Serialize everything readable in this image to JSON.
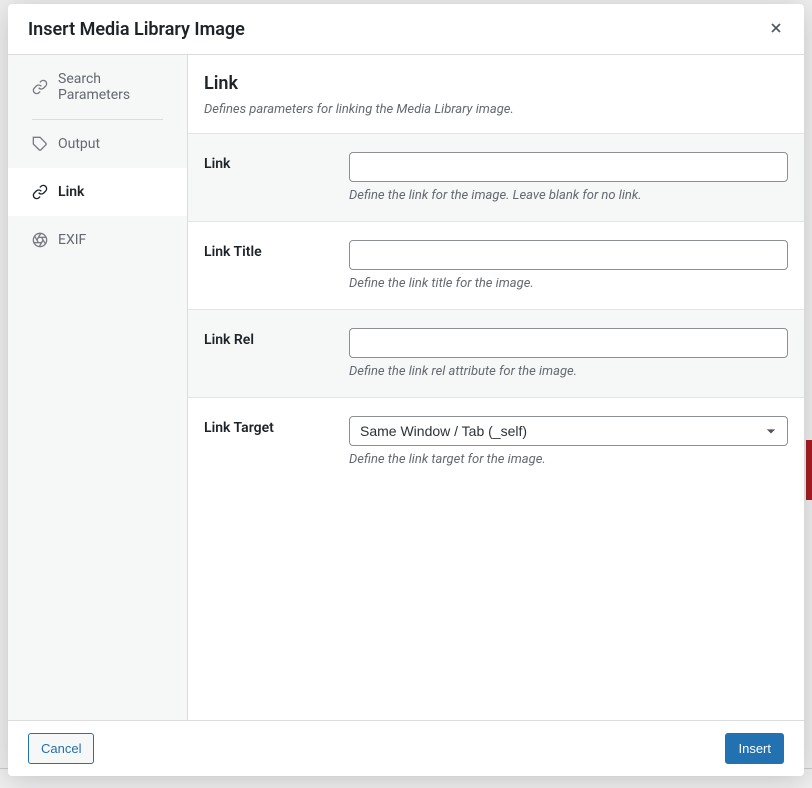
{
  "modal": {
    "title": "Insert Media Library Image"
  },
  "sidebar": {
    "items": [
      {
        "label": "Search Parameters"
      },
      {
        "label": "Output"
      },
      {
        "label": "Link"
      },
      {
        "label": "EXIF"
      }
    ]
  },
  "content": {
    "title": "Link",
    "description": "Defines parameters for linking the Media Library image."
  },
  "form": {
    "link": {
      "label": "Link",
      "value": "",
      "hint": "Define the link for the image. Leave blank for no link."
    },
    "link_title": {
      "label": "Link Title",
      "value": "",
      "hint": "Define the link title for the image."
    },
    "link_rel": {
      "label": "Link Rel",
      "value": "",
      "hint": "Define the link rel attribute for the image."
    },
    "link_target": {
      "label": "Link Target",
      "selected": "Same Window / Tab (_self)",
      "hint": "Define the link target for the image."
    }
  },
  "footer": {
    "cancel": "Cancel",
    "insert": "Insert"
  }
}
